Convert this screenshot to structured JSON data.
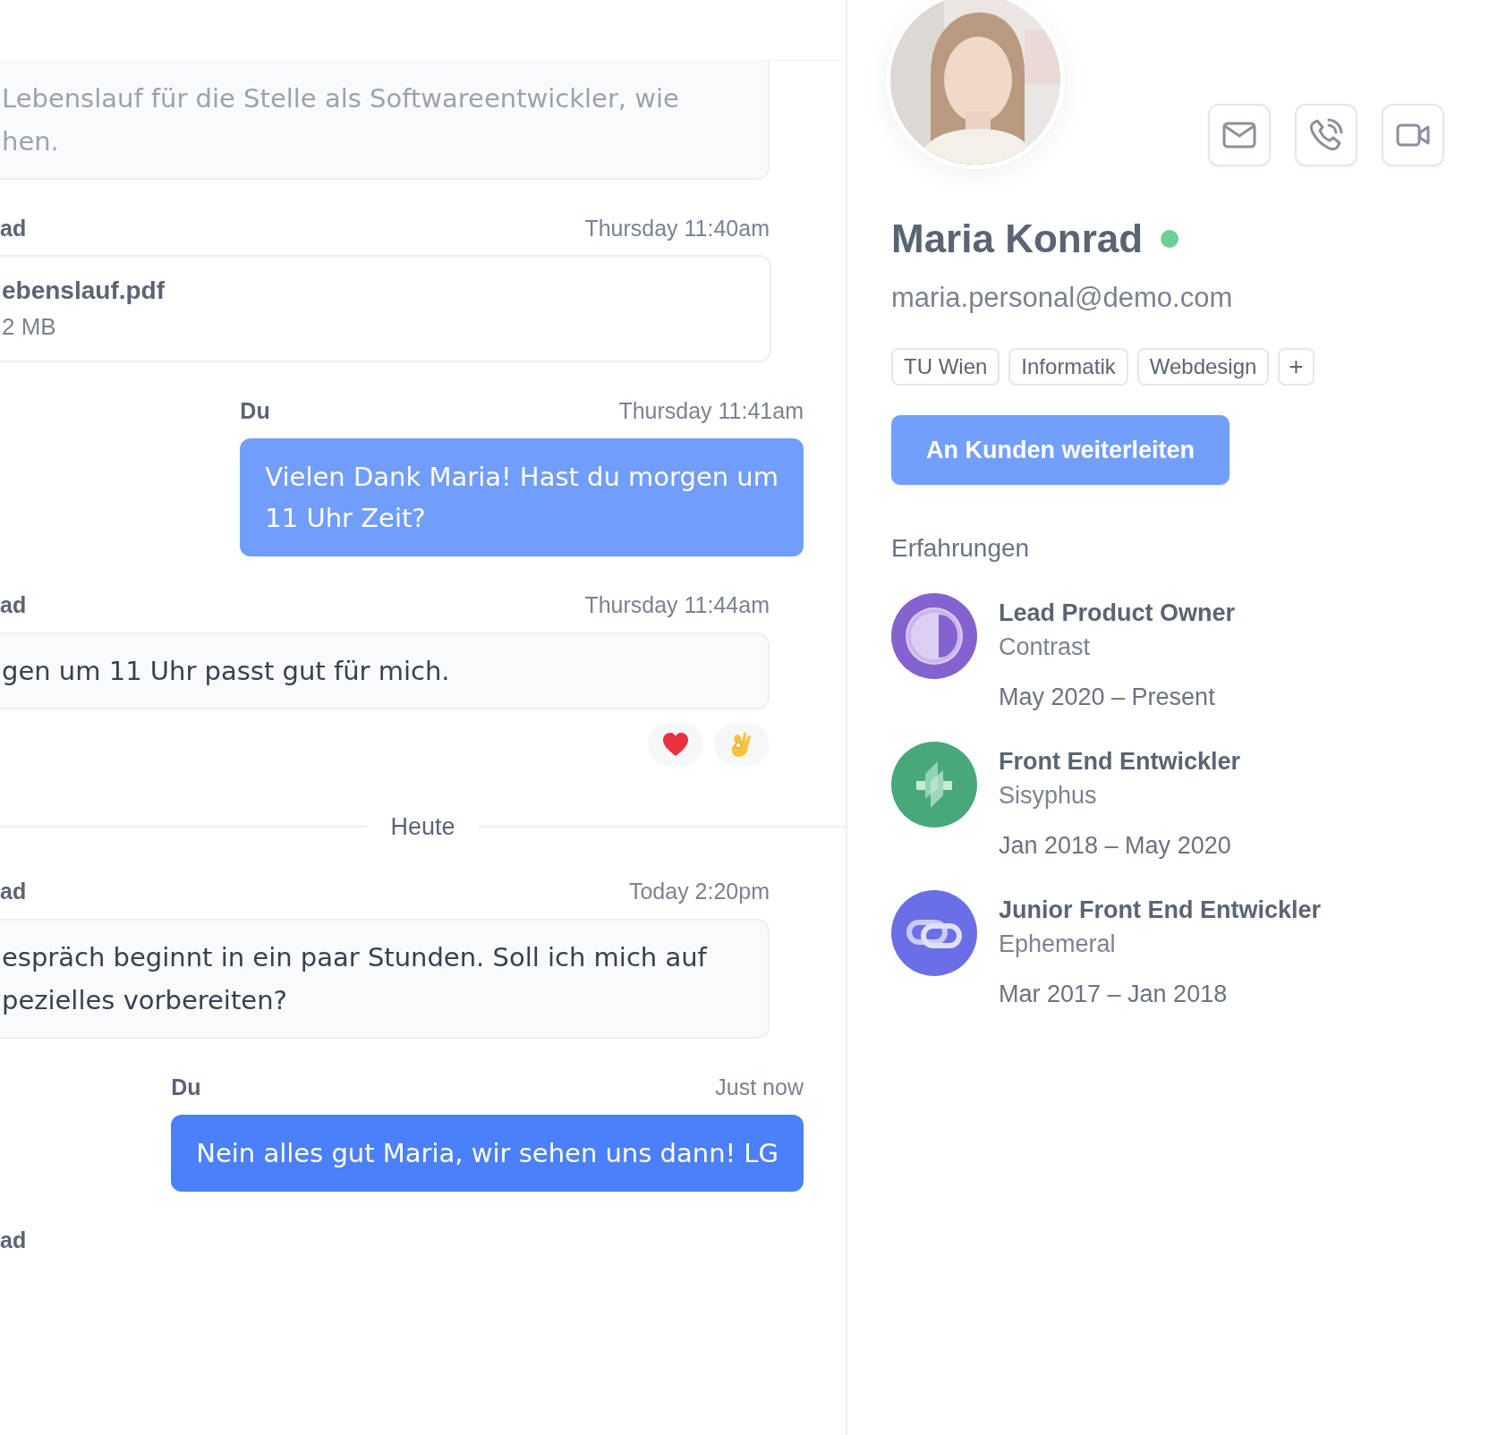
{
  "thread": [
    {
      "kind": "incoming",
      "text": "Lebenslauf für die Stelle als Softwareentwickler, wie\nhen."
    },
    {
      "kind": "file",
      "sender": "ad",
      "time": "Thursday 11:40am",
      "file_name": "ebenslauf.pdf",
      "file_size": "2 MB"
    },
    {
      "kind": "outgoing",
      "sender": "Du",
      "time": "Thursday 11:41am",
      "text": "Vielen Dank Maria! Hast du morgen um\n11 Uhr Zeit?",
      "color": "#719dfd"
    },
    {
      "kind": "incoming",
      "sender": "ad",
      "time": "Thursday 11:44am",
      "text": "gen um 11 Uhr passt gut für mich.",
      "reactions": [
        {
          "kind": "heart"
        },
        {
          "kind": "ok"
        }
      ]
    },
    {
      "kind": "divider",
      "label": "Heute"
    },
    {
      "kind": "incoming",
      "sender": "ad",
      "time": "Today 2:20pm",
      "text": "espräch beginnt in ein paar Stunden. Soll ich mich auf\npezielles vorbereiten?"
    },
    {
      "kind": "outgoing",
      "sender": "Du",
      "time": "Just now",
      "text": "Nein alles gut Maria, wir sehen uns dann! LG",
      "color": "#4a80fb"
    },
    {
      "kind": "sender",
      "sender": "ad"
    }
  ],
  "profile": {
    "name": "Maria Konrad",
    "online": true,
    "email": "maria.personal@demo.com",
    "tags": [
      "TU Wien",
      "Informatik",
      "Webdesign"
    ],
    "add_tag": "+",
    "forward_button": "An Kunden weiterleiten",
    "experience_title": "Erfahrungen",
    "experiences": [
      {
        "title": "Lead Product Owner",
        "company": "Contrast",
        "period": "May 2020 – Present",
        "kind": "halfmoon",
        "color": "#8462cf"
      },
      {
        "title": "Front End Entwickler",
        "company": "Sisyphus",
        "period": "Jan 2018 – May 2020",
        "kind": "bolt",
        "color": "#48a87a"
      },
      {
        "title": "Junior Front End Entwickler",
        "company": "Ephemeral",
        "period": "Mar 2017 – Jan 2018",
        "kind": "link",
        "color": "#6a6fe8"
      }
    ]
  }
}
